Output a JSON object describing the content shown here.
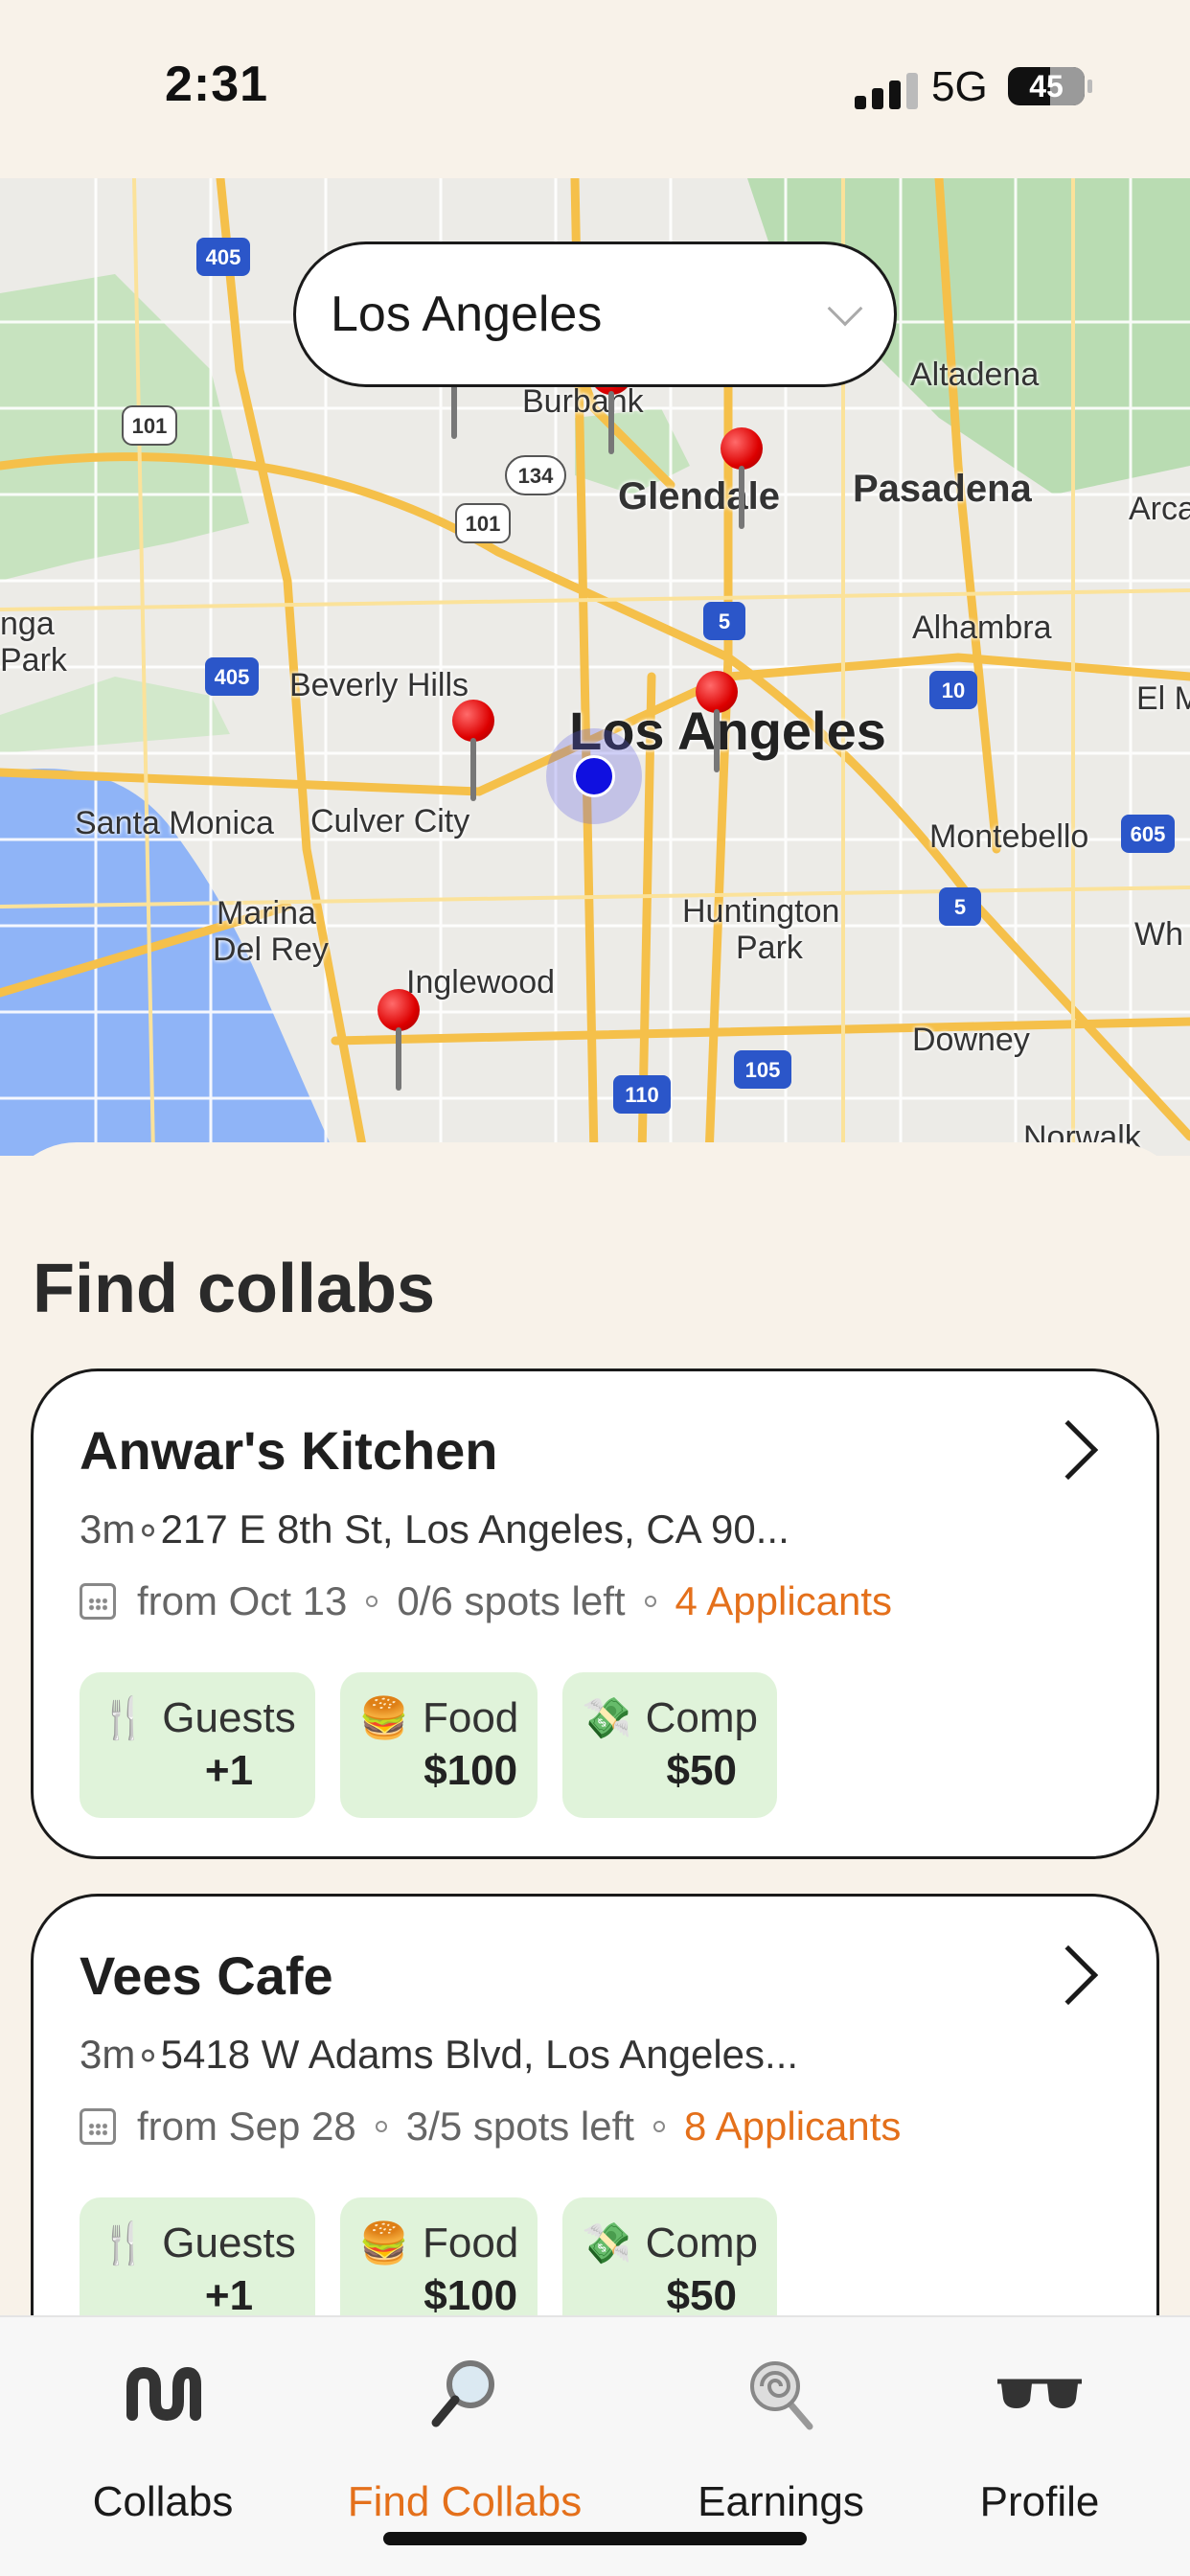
{
  "status_bar": {
    "time": "2:31",
    "network": "5G",
    "battery": "45"
  },
  "map": {
    "city_select": {
      "value": "Los Angeles"
    },
    "labels": {
      "burbank": "Burbank",
      "altadena": "Altadena",
      "glendale": "Glendale",
      "pasadena": "Pasadena",
      "arcadia": "Arca",
      "alhambra": "Alhambra",
      "el_monte": "El M",
      "beverly_hills": "Beverly Hills",
      "los_angeles": "Los Angeles",
      "santa_monica": "Santa Monica",
      "culver_city": "Culver City",
      "montebello": "Montebello",
      "marina": "Marina",
      "del_rey": "Del Rey",
      "huntington": "Huntington",
      "park": "Park",
      "inglewood": "Inglewood",
      "downey": "Downey",
      "norwalk": "Norwalk",
      "whittier": "Wh",
      "topanga_1": "nga",
      "topanga_2": "Park"
    },
    "shields": {
      "i405_top": "405",
      "us101_left": "101",
      "sr134": "134",
      "us101_mid": "101",
      "i5_mid": "5",
      "i405_mid": "405",
      "i10": "10",
      "i605": "605",
      "i5_lower": "5",
      "i110": "110",
      "i105": "105"
    }
  },
  "sheet": {
    "title": "Find collabs"
  },
  "cards": [
    {
      "name": "Anwar's Kitchen",
      "distance": "3m",
      "address": "217 E 8th St, Los Angeles, CA 90...",
      "date": "from Oct 13",
      "spots": "0/6 spots left",
      "applicants": "4 Applicants",
      "perks": [
        {
          "icon": "fork-knife-icon",
          "emoji": "🍴",
          "label": "Guests",
          "value": "+1"
        },
        {
          "icon": "burger-icon",
          "emoji": "🍔",
          "label": "Food",
          "value": "$100"
        },
        {
          "icon": "money-icon",
          "emoji": "💸",
          "label": "Comp",
          "value": "$50"
        }
      ]
    },
    {
      "name": "Vees Cafe",
      "distance": "3m",
      "address": "5418 W Adams Blvd, Los Angeles...",
      "date": "from Sep 28",
      "spots": "3/5 spots left",
      "applicants": "8 Applicants",
      "perks": [
        {
          "icon": "fork-knife-icon",
          "emoji": "🍴",
          "label": "Guests",
          "value": "+1"
        },
        {
          "icon": "burger-icon",
          "emoji": "🍔",
          "label": "Food",
          "value": "$100"
        },
        {
          "icon": "money-icon",
          "emoji": "💸",
          "label": "Comp",
          "value": "$50"
        }
      ]
    }
  ],
  "tabs": [
    {
      "label": "Collabs",
      "icon": "collabs-logo-icon",
      "active": false
    },
    {
      "label": "Find Collabs",
      "icon": "magnifier-icon",
      "active": true
    },
    {
      "label": "Earnings",
      "icon": "lollipop-icon",
      "active": false
    },
    {
      "label": "Profile",
      "icon": "sunglasses-icon",
      "active": false
    }
  ],
  "colors": {
    "accent": "#e4701b",
    "perk_bg": "#e0f3da",
    "background": "#f8f2e9",
    "pin": "#dd0000",
    "location": "#1010e0"
  }
}
